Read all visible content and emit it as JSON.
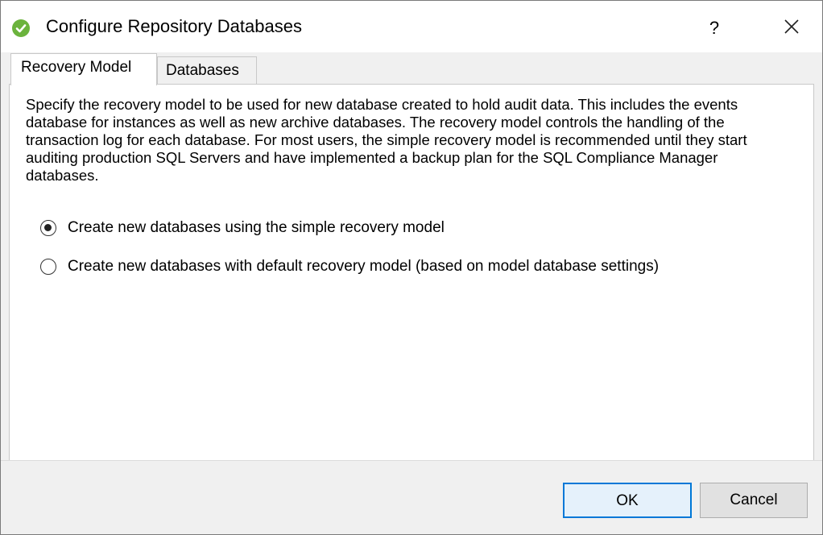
{
  "window": {
    "title": "Configure Repository Databases",
    "help_label": "?",
    "icon": "green-check-circle-icon",
    "close_icon": "close-icon"
  },
  "tabs": [
    {
      "label": "Recovery Model",
      "active": true
    },
    {
      "label": "Databases",
      "active": false
    }
  ],
  "recovery_model": {
    "description": "Specify the recovery model to be used for new database created to hold audit data. This includes the events database for instances as well as new archive databases. The recovery model controls the handling of the transaction log for each database. For most users, the simple recovery model is recommended until they start auditing production SQL Servers and have implemented a backup plan for the SQL Compliance Manager databases.",
    "options": [
      {
        "label": "Create new databases using the simple recovery model",
        "selected": true
      },
      {
        "label": "Create new databases with default recovery model (based on model database settings)",
        "selected": false
      }
    ]
  },
  "buttons": {
    "ok_label": "OK",
    "cancel_label": "Cancel"
  },
  "colors": {
    "icon_green": "#6bb33d",
    "accent_blue": "#0078d7"
  }
}
